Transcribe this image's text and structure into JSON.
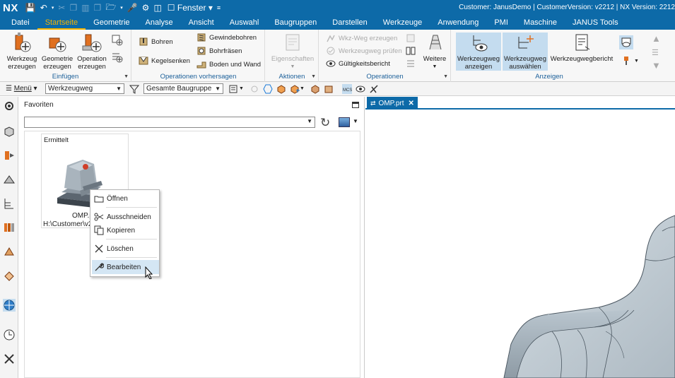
{
  "titlebar": {
    "logo": "NX",
    "fenster": "Fenster",
    "info": "Customer: JanusDemo | CustomerVersion: v2212 | NX Version: 2212"
  },
  "menubar": {
    "tabs": [
      "Datei",
      "Startseite",
      "Geometrie",
      "Analyse",
      "Ansicht",
      "Auswahl",
      "Baugruppen",
      "Darstellen",
      "Werkzeuge",
      "Anwendung",
      "PMI",
      "Maschine",
      "JANUS Tools"
    ],
    "active": "Startseite"
  },
  "ribbon": {
    "einfuegen": {
      "label": "Einfügen",
      "werkzeug": [
        "Werkzeug",
        "erzeugen"
      ],
      "geometrie": [
        "Geometrie",
        "erzeugen"
      ],
      "operation": [
        "Operation",
        "erzeugen"
      ]
    },
    "operationen_vorhersagen": {
      "label": "Operationen vorhersagen",
      "bohren": "Bohren",
      "kegelsenken": "Kegelsenken",
      "gewindebohren": "Gewindebohren",
      "bohrfraesen": "Bohrfräsen",
      "boden_und_wand": "Boden und Wand"
    },
    "aktionen": {
      "label": "Aktionen",
      "eigenschaften": "Eigenschaften"
    },
    "operationen": {
      "label": "Operationen",
      "wkz_weg_erzeugen": "Wkz-Weg erzeugen",
      "werkzeugweg_pruefen": "Werkzeugweg prüfen",
      "gueltigkeitsbericht": "Gültigkeitsbericht",
      "weitere": "Weitere"
    },
    "anzeigen": {
      "label": "Anzeigen",
      "werkzeugweg_anzeigen": [
        "Werkzeugweg",
        "anzeigen"
      ],
      "werkzeugweg_auswaehlen": [
        "Werkzeugweg",
        "auswählen"
      ],
      "werkzeugwegbericht": "Werkzeugwegbericht"
    }
  },
  "toolbar2": {
    "menu": "Menü",
    "filter": "Werkzeugweg",
    "scope": "Gesamte Baugruppe"
  },
  "panel": {
    "title": "Favoriten",
    "search_value": "",
    "tile": {
      "header": "Ermittelt",
      "name": "OMP.prt",
      "path": "H:\\Customer\\v2212"
    }
  },
  "context_menu": {
    "items": [
      "Öffnen",
      "Ausschneiden",
      "Kopieren",
      "Löschen",
      "Bearbeiten"
    ],
    "hovered": "Bearbeiten"
  },
  "graphics": {
    "tab": "OMP.prt"
  },
  "colors": {
    "brand": "#0d6aa8",
    "active_tab": "#f5b400",
    "group_label": "#1b5f99",
    "selected": "#c4dcef",
    "part_fill": "#c5d1d8"
  }
}
